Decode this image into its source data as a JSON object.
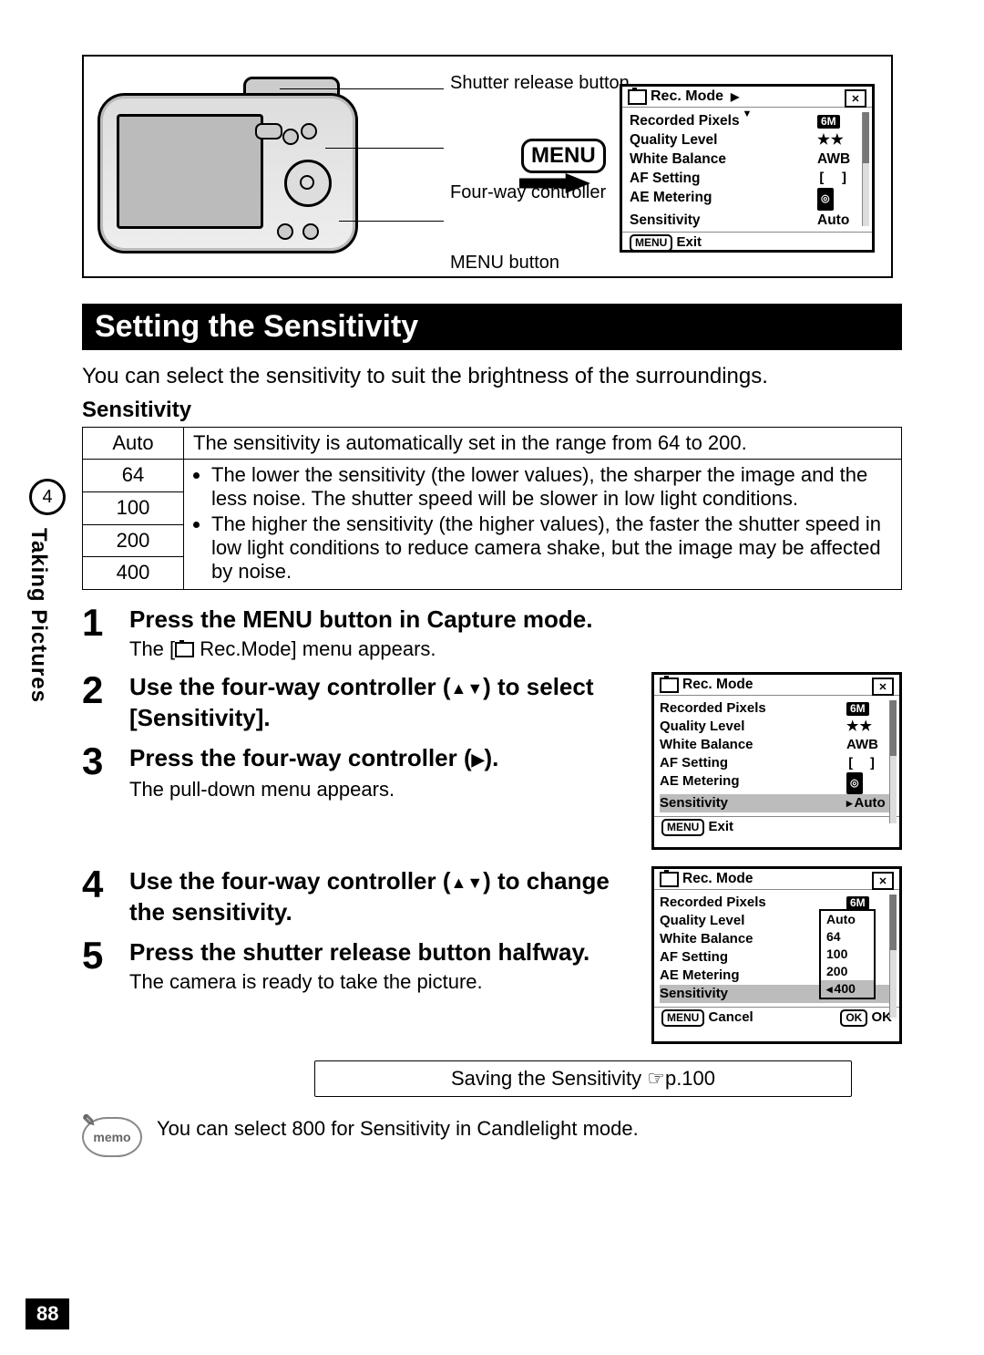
{
  "chapter": {
    "number": "4",
    "name": "Taking Pictures"
  },
  "page_number": "88",
  "diagram_labels": {
    "shutter_release": "Shutter release button",
    "four_way": "Four-way controller",
    "menu_button": "MENU button",
    "menu_word": "MENU"
  },
  "rec_mode_title": "Rec. Mode",
  "rec_mode_items": {
    "recorded_pixels": {
      "label": "Recorded Pixels",
      "value": "6M"
    },
    "quality_level": {
      "label": "Quality Level",
      "value": "★★"
    },
    "white_balance": {
      "label": "White Balance",
      "value": "AWB"
    },
    "af_setting": {
      "label": "AF Setting"
    },
    "ae_metering": {
      "label": "AE Metering"
    },
    "sensitivity": {
      "label": "Sensitivity",
      "value": "Auto"
    }
  },
  "footer": {
    "menu_btn": "MENU",
    "exit": "Exit",
    "cancel": "Cancel",
    "ok_btn": "OK",
    "ok": "OK"
  },
  "title": "Setting the Sensitivity",
  "intro": "You can select the sensitivity to suit the brightness of the surroundings.",
  "table_heading": "Sensitivity",
  "table": {
    "auto_label": "Auto",
    "auto_desc": "The sensitivity is automatically set in the range from 64 to 200.",
    "vals": {
      "a": "64",
      "b": "100",
      "c": "200",
      "d": "400"
    },
    "bullet1": "The lower the sensitivity (the lower values), the sharper the image and the less noise. The shutter speed will be slower in low light conditions.",
    "bullet2": "The higher the sensitivity (the higher values), the faster the shutter speed in low light conditions to reduce camera shake, but the image may be affected by noise."
  },
  "steps": {
    "s1": {
      "title": "Press the MENU button in Capture mode.",
      "text_a": "The [",
      "text_b": " Rec.Mode] menu appears."
    },
    "s2": {
      "title_a": "Use the four-way controller (",
      "title_b": ") to select [Sensitivity]."
    },
    "s3": {
      "title_a": "Press the four-way controller (",
      "title_b": ").",
      "text": "The pull-down menu appears."
    },
    "s4": {
      "title_a": "Use the four-way controller (",
      "title_b": ") to change the sensitivity."
    },
    "s5": {
      "title": "Press the shutter release button halfway.",
      "text": "The camera is ready to take the picture."
    }
  },
  "dropdown": {
    "auto": "Auto",
    "a": "64",
    "b": "100",
    "c": "200",
    "d": "400"
  },
  "xref": {
    "text": "Saving the Sensitivity ",
    "page": "p.100"
  },
  "memo": "You can select 800 for Sensitivity in Candlelight mode."
}
